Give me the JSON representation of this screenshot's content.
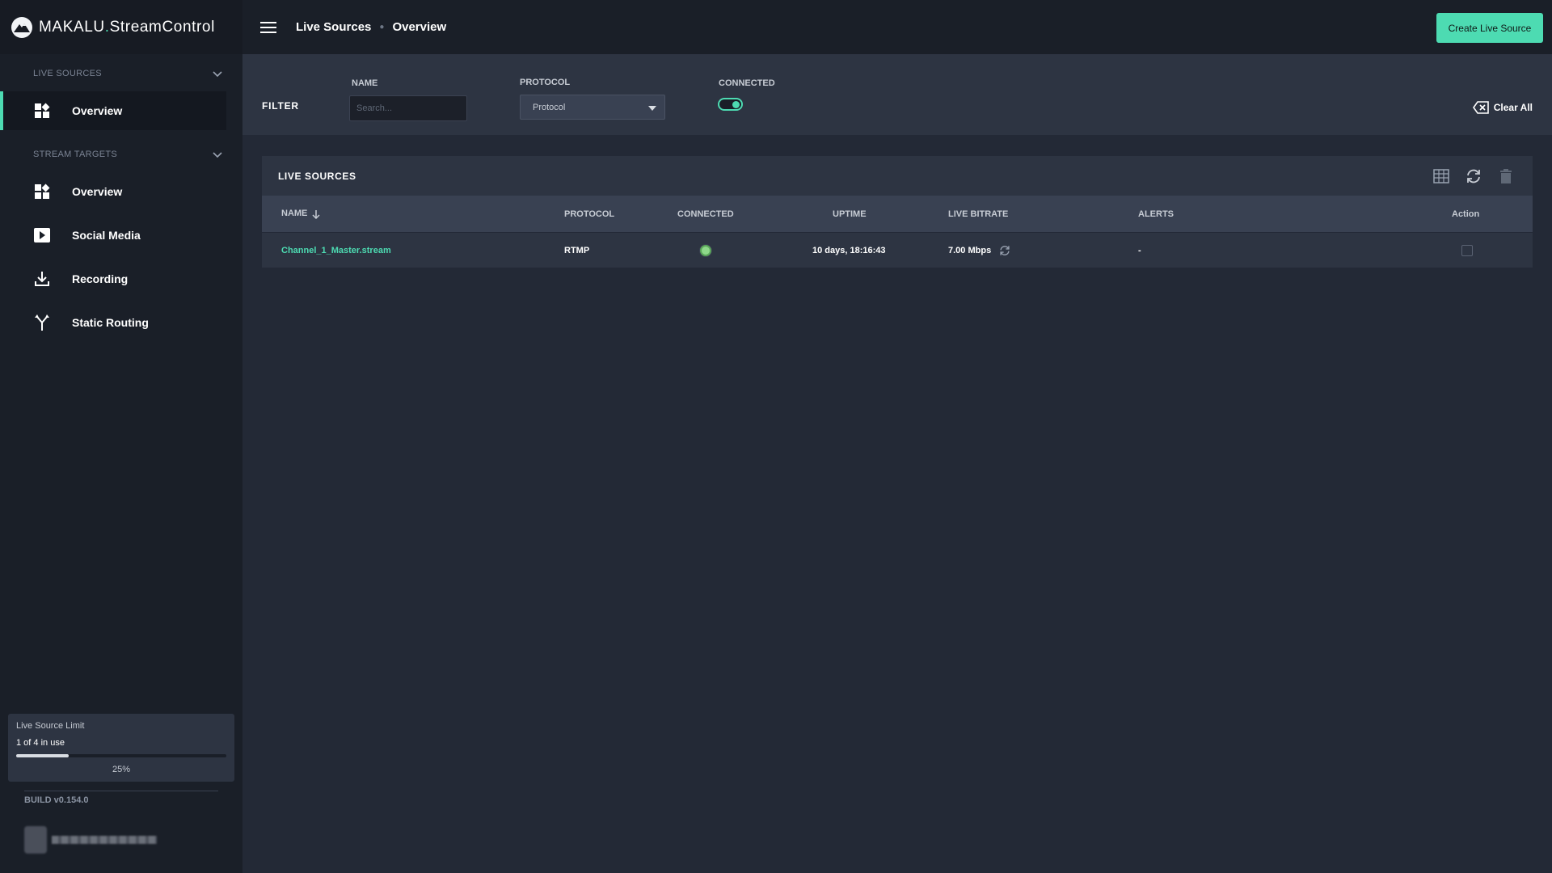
{
  "brand": {
    "name": "MAKALU",
    "dot": ".",
    "product": "StreamControl"
  },
  "sidebar": {
    "sections": [
      {
        "label": "LIVE SOURCES",
        "items": [
          {
            "label": "Overview",
            "icon": "dashboard-icon",
            "active": true
          }
        ]
      },
      {
        "label": "STREAM TARGETS",
        "items": [
          {
            "label": "Overview",
            "icon": "dashboard-icon"
          },
          {
            "label": "Social Media",
            "icon": "play-icon"
          },
          {
            "label": "Recording",
            "icon": "download-icon"
          },
          {
            "label": "Static Routing",
            "icon": "routing-icon"
          }
        ]
      }
    ],
    "limit": {
      "title": "Live Source Limit",
      "usage": "1 of 4 in use",
      "percent_label": "25%",
      "fraction": 0.25
    },
    "build": "BUILD v0.154.0"
  },
  "header": {
    "breadcrumbs": [
      "Live Sources",
      "Overview"
    ],
    "create_button": "Create Live Source"
  },
  "filter": {
    "label": "FILTER",
    "name_label": "NAME",
    "name_placeholder": "Search...",
    "protocol_label": "PROTOCOL",
    "protocol_value": "Protocol",
    "connected_label": "CONNECTED",
    "connected_on": true,
    "clear_all": "Clear All"
  },
  "table": {
    "title": "LIVE SOURCES",
    "columns": [
      "NAME",
      "PROTOCOL",
      "CONNECTED",
      "UPTIME",
      "LIVE BITRATE",
      "ALERTS",
      "Action"
    ],
    "rows": [
      {
        "name": "Channel_1_Master.stream",
        "protocol": "RTMP",
        "connected": true,
        "uptime": "10 days, 18:16:43",
        "bitrate": "7.00 Mbps",
        "alerts": "-"
      }
    ]
  },
  "colors": {
    "accent": "#4ddbb2",
    "sidebar": "#1a1f28",
    "panel": "#2d3442"
  }
}
